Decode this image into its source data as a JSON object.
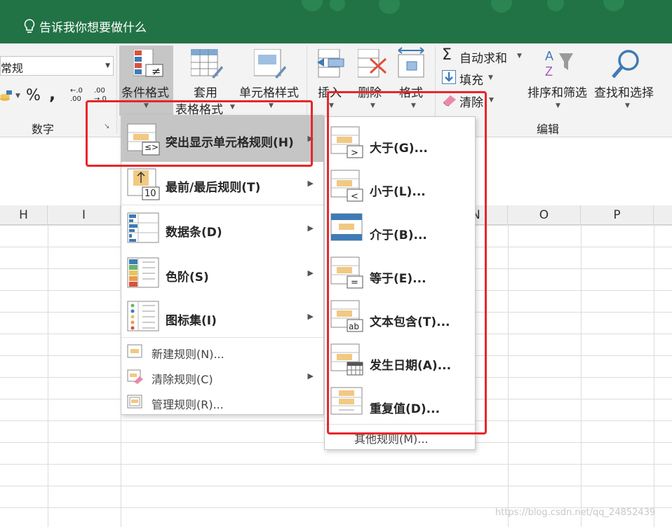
{
  "title_bar": {
    "tell_me": "告诉我你想要做什么"
  },
  "ribbon": {
    "number": {
      "format_value": "常规",
      "percent_label": "%",
      "comma_label": ",",
      "inc_decimal_label": "←.0 .00",
      "dec_decimal_label": ".00 →.0",
      "group_label": "数字"
    },
    "styles": {
      "conditional_format_label": "条件格式",
      "table_format_label_1": "套用",
      "table_format_label_2": "表格格式",
      "cell_styles_label": "单元格样式"
    },
    "cells": {
      "insert_label": "插入",
      "delete_label": "删除",
      "format_label": "格式"
    },
    "editing": {
      "autosum_label": "自动求和",
      "fill_label": "填充",
      "clear_label": "清除",
      "sort_filter_label": "排序和筛选",
      "find_select_label": "查找和选择",
      "group_label": "编辑"
    }
  },
  "sheet": {
    "columns": [
      "H",
      "I",
      "N",
      "O",
      "P"
    ]
  },
  "conditional_menu": {
    "items": [
      {
        "label": "突出显示单元格规则(H)"
      },
      {
        "label": "最前/最后规则(T)"
      },
      {
        "label": "数据条(D)"
      },
      {
        "label": "色阶(S)"
      },
      {
        "label": "图标集(I)"
      },
      {
        "label": "新建规则(N)..."
      },
      {
        "label": "清除规则(C)"
      },
      {
        "label": "管理规则(R)..."
      }
    ]
  },
  "highlight_submenu": {
    "items": [
      {
        "label": "大于(G)...",
        "icon_glyph": ">"
      },
      {
        "label": "小于(L)...",
        "icon_glyph": "<"
      },
      {
        "label": "介于(B)..."
      },
      {
        "label": "等于(E)...",
        "icon_glyph": "="
      },
      {
        "label": "文本包含(T)...",
        "icon_glyph": "ab"
      },
      {
        "label": "发生日期(A)..."
      },
      {
        "label": "重复值(D)..."
      }
    ],
    "more_rules": "其他规则(M)..."
  },
  "icon_glyphs": {
    "conditional_badge": "≠",
    "highlight_badge": "≤>",
    "top_bottom_badge": "10",
    "sum_symbol": "Σ"
  },
  "watermark": "https://blog.csdn.net/qq_24852439",
  "colors": {
    "titlebar": "#217346",
    "highlight_fill": "#f1c982",
    "annotation": "#e8262a",
    "menu_hover": "#c5c5c5"
  }
}
